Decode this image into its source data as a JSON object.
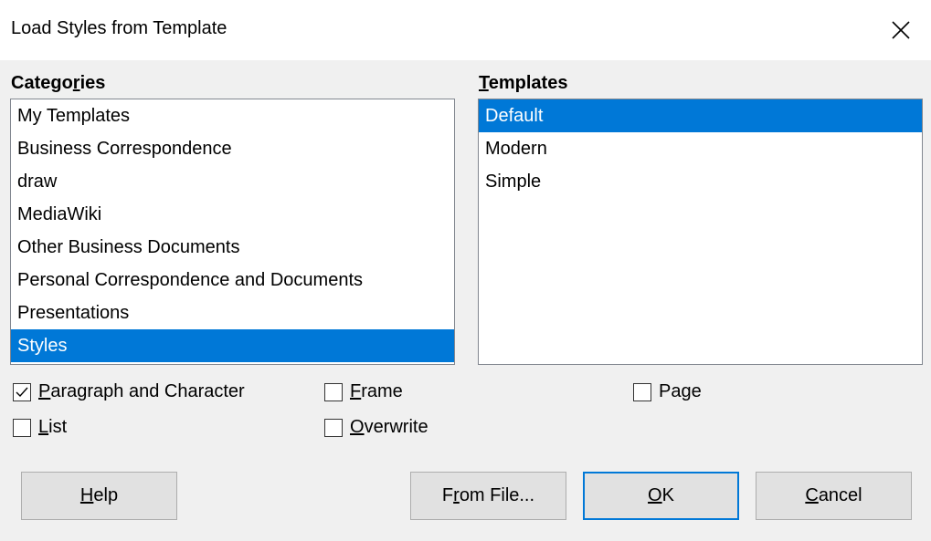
{
  "window": {
    "title": "Load Styles from Template"
  },
  "categories": {
    "label_pre": "Catego",
    "label_accel": "r",
    "label_post": "ies",
    "items": [
      "My Templates",
      "Business Correspondence",
      "draw",
      "MediaWiki",
      "Other Business Documents",
      "Personal Correspondence and Documents",
      "Presentations",
      "Styles"
    ],
    "selected": "Styles"
  },
  "templates": {
    "label_accel": "T",
    "label_post": "emplates",
    "items": [
      "Default",
      "Modern",
      "Simple"
    ],
    "selected": "Default"
  },
  "options": {
    "paragraph": {
      "accel": "P",
      "rest": "aragraph and Character",
      "checked": true
    },
    "frame": {
      "accel": "F",
      "rest": "rame",
      "checked": false
    },
    "page": {
      "pre": "Pa",
      "accel": "g",
      "rest": "e",
      "checked": false
    },
    "list": {
      "accel": "L",
      "rest": "ist",
      "checked": false
    },
    "overwrite": {
      "accel": "O",
      "rest": "verwrite",
      "checked": false
    }
  },
  "buttons": {
    "help": {
      "accel": "H",
      "rest": "elp"
    },
    "from_file": {
      "pre": "F",
      "accel": "r",
      "rest": "om File..."
    },
    "ok": {
      "accel": "O",
      "rest": "K"
    },
    "cancel": {
      "accel": "C",
      "rest": "ancel"
    }
  },
  "colors": {
    "selection": "#0078d7",
    "background": "#f0f0f0"
  }
}
